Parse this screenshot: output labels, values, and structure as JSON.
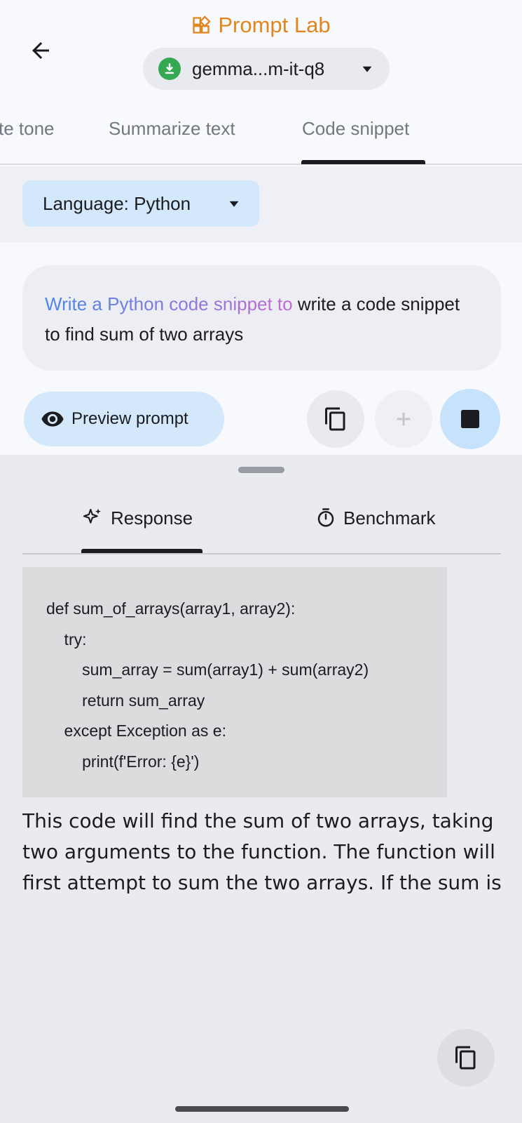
{
  "header": {
    "title": "Prompt Lab",
    "model_name": "gemma...m-it-q8"
  },
  "tabs": [
    {
      "label": "te tone"
    },
    {
      "label": "Summarize text"
    },
    {
      "label": "Code snippet",
      "selected": true
    }
  ],
  "language": {
    "label": "Language: Python"
  },
  "prompt": {
    "prefix": "Write a Python code snippet to",
    "text": " write a code snippet to find sum of two arrays"
  },
  "actions": {
    "preview_label": "Preview prompt"
  },
  "result_tabs": [
    {
      "label": "Response",
      "selected": true
    },
    {
      "label": "Benchmark"
    }
  ],
  "response": {
    "code": "def sum_of_arrays(array1, array2):\n    try:\n        sum_array = sum(array1) + sum(array2)\n        return sum_array\n    except Exception as e:\n        print(f'Error: {e}')",
    "text": "This code will find the sum of two arrays, taking two arguments to the function.  The function will first attempt to sum the two arrays. If the sum is"
  },
  "colors": {
    "accent": "#e0861f",
    "chip_blue": "#d3e8fb",
    "download_green": "#34a853"
  }
}
